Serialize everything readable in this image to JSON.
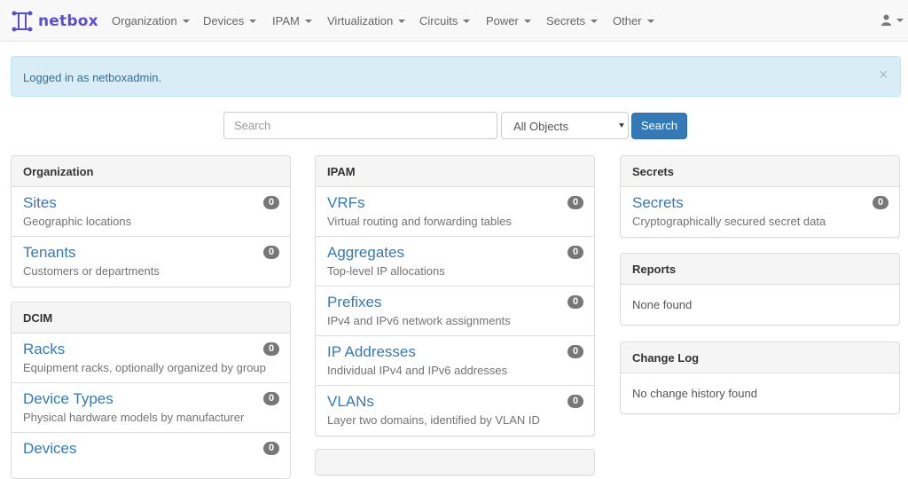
{
  "navbar": {
    "brand": "netbox",
    "brand_color": "#5a4fcf",
    "menu": [
      "Organization",
      "Devices",
      "IPAM",
      "Virtualization",
      "Circuits",
      "Power",
      "Secrets",
      "Other"
    ],
    "user_icon": "user-icon"
  },
  "alert": {
    "message": "Logged in as netboxadmin.",
    "close": "×"
  },
  "search": {
    "placeholder": "Search",
    "scope_selected": "All Objects",
    "button_label": "Search"
  },
  "panels": {
    "organization": {
      "title": "Organization",
      "items": [
        {
          "title": "Sites",
          "description": "Geographic locations",
          "count": "0"
        },
        {
          "title": "Tenants",
          "description": "Customers or departments",
          "count": "0"
        }
      ]
    },
    "dcim": {
      "title": "DCIM",
      "items": [
        {
          "title": "Racks",
          "description": "Equipment racks, optionally organized by group",
          "count": "0"
        },
        {
          "title": "Device Types",
          "description": "Physical hardware models by manufacturer",
          "count": "0"
        },
        {
          "title": "Devices",
          "description": "",
          "count": "0"
        }
      ]
    },
    "ipam": {
      "title": "IPAM",
      "items": [
        {
          "title": "VRFs",
          "description": "Virtual routing and forwarding tables",
          "count": "0"
        },
        {
          "title": "Aggregates",
          "description": "Top-level IP allocations",
          "count": "0"
        },
        {
          "title": "Prefixes",
          "description": "IPv4 and IPv6 network assignments",
          "count": "0"
        },
        {
          "title": "IP Addresses",
          "description": "Individual IPv4 and IPv6 addresses",
          "count": "0"
        },
        {
          "title": "VLANs",
          "description": "Layer two domains, identified by VLAN ID",
          "count": "0"
        }
      ]
    },
    "secrets": {
      "title": "Secrets",
      "items": [
        {
          "title": "Secrets",
          "description": "Cryptographically secured secret data",
          "count": "0"
        }
      ]
    },
    "reports": {
      "title": "Reports",
      "body": "None found"
    },
    "changelog": {
      "title": "Change Log",
      "body": "No change history found"
    }
  }
}
